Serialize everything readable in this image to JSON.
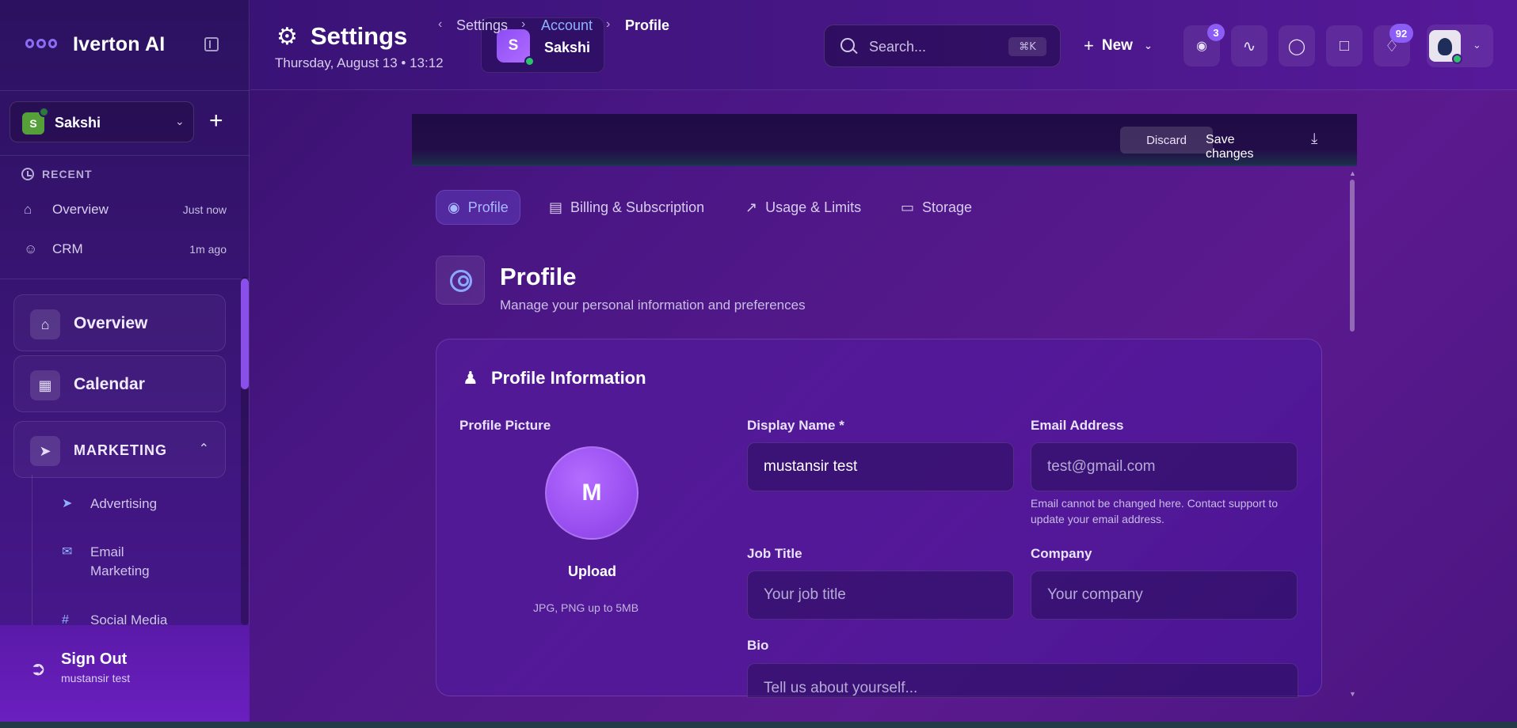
{
  "colors": {
    "accent": "#8b5cf6",
    "link": "#8fb2ff",
    "online": "#2cc46a",
    "workspace": "#55a038"
  },
  "sidebar": {
    "brand": "Iverton AI",
    "workspace": {
      "initial": "S",
      "name": "Sakshi"
    },
    "recent_heading": "RECENT",
    "recent": [
      {
        "label": "Overview",
        "time": "Just now",
        "icon": "home-icon"
      },
      {
        "label": "CRM",
        "time": "1m ago",
        "icon": "user-check-icon"
      }
    ],
    "nav": [
      {
        "label": "Overview",
        "icon": "home-icon"
      },
      {
        "label": "Calendar",
        "icon": "calendar-icon"
      },
      {
        "label": "MARKETING",
        "icon": "megaphone-icon",
        "expanded": true
      }
    ],
    "marketing_items": [
      {
        "label": "Advertising",
        "icon": "megaphone-icon"
      },
      {
        "label": "Email Marketing",
        "icon": "mail-icon"
      },
      {
        "label": "Social Media",
        "icon": "hash-icon"
      }
    ],
    "signout": {
      "label": "Sign Out",
      "user": "mustansir test"
    }
  },
  "header": {
    "title": "Settings",
    "date": "Thursday, August 13 • 13:12",
    "user": {
      "initial": "S",
      "name": "Sakshi"
    },
    "search": {
      "placeholder": "Search...",
      "shortcut": "⌘K"
    },
    "new_label": "New",
    "badges": {
      "ai": "3",
      "notifications": "92"
    }
  },
  "breadcrumb": {
    "items": [
      "Settings",
      "Account",
      "Profile"
    ],
    "discard": "Discard",
    "save": "Save changes"
  },
  "tabs": [
    {
      "label": "Profile",
      "icon": "user-circle-icon",
      "active": true
    },
    {
      "label": "Billing & Subscription",
      "icon": "credit-card-icon",
      "active": false
    },
    {
      "label": "Usage & Limits",
      "icon": "trending-up-icon",
      "active": false
    },
    {
      "label": "Storage",
      "icon": "hard-drive-icon",
      "active": false
    }
  ],
  "section": {
    "title": "Profile",
    "subtitle": "Manage your personal information and preferences"
  },
  "card": {
    "title": "Profile Information",
    "picture": {
      "label": "Profile Picture",
      "initial": "M",
      "upload": "Upload",
      "hint": "JPG, PNG up to 5MB"
    },
    "fields": {
      "display_name": {
        "label": "Display Name *",
        "value": "mustansir test"
      },
      "email": {
        "label": "Email Address",
        "placeholder": "test@gmail.com",
        "help": "Email cannot be changed here. Contact support to update your email address."
      },
      "job_title": {
        "label": "Job Title",
        "placeholder": "Your job title"
      },
      "company": {
        "label": "Company",
        "placeholder": "Your company"
      },
      "bio": {
        "label": "Bio",
        "placeholder": "Tell us about yourself..."
      }
    }
  }
}
